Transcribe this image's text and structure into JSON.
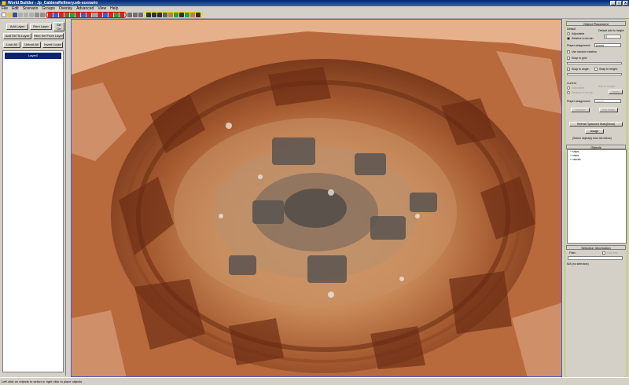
{
  "window": {
    "title": "World Builder - Jp_CalderaRefinery.wb-scenario",
    "controls": [
      "_",
      "□",
      "x"
    ]
  },
  "menu": [
    "File",
    "Edit",
    "Scenario",
    "Groups",
    "Overlay",
    "Advanced",
    "View",
    "Help"
  ],
  "colors": {
    "red_annotation": "#e00000",
    "yellow_annotation": "#e6d800",
    "green_annotation": "#a6d43c",
    "viewport_border": "#4a5bd0",
    "terrain": "#c77a45"
  },
  "left_panel": {
    "add_layer": "Add Layer",
    "rem_layer": "Rem Layer",
    "sel_on": "Sel On",
    "add_sel_to_layer": "Add Sel To Layer",
    "rem_sel_from_layer": "Rem Sel From Layer",
    "lock_all": "Lock All",
    "unlock_all": "Unlock All",
    "invert_locks": "Invert Locks",
    "layer_item": "Layer0"
  },
  "object_placement": {
    "header": "Object Placement",
    "default_label": "Default",
    "adjustable": "Adjustable",
    "relative_to_terrain": "Relative to terrain",
    "default_add_to_height": "Default add to height:",
    "height_value": "0",
    "player_assignment": "Player assignment:",
    "player_value": "(none)",
    "use_random_rotation": "Use random rotation",
    "snap_to_grid": "Snap to grid:",
    "snap_to_angle": "Snap to angle:",
    "snap_to_height": "Snap to height:",
    "current_label": "Current",
    "current_adjustable": "Adjustable",
    "current_relative": "Relative to terrain",
    "add_to_height": "Add to height:",
    "apply": "Apply",
    "current_player_assignment": "Player assignment:",
    "current_player_value": "(none)",
    "activate": "Activate",
    "edit_water": "Edit Water",
    "refresh_button": "Refresh Spawned Stats(Decal)",
    "assign_button": "Assign",
    "hint": "(Select object(s) from list below)"
  },
  "objects": {
    "header": "Objects",
    "items": [
      "ships",
      "ships",
      "visuals"
    ]
  },
  "selection_info": {
    "header": "Selection Information",
    "filter": "Filter:",
    "use_filter": "Use filter",
    "status": "N/A (no selection)"
  },
  "status_bar": "Left click on objects to select or right click to place objects"
}
